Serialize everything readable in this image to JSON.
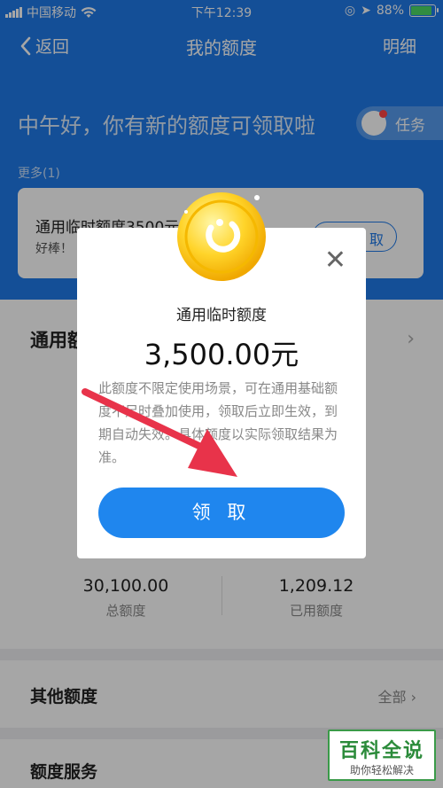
{
  "status_bar": {
    "carrier": "中国移动",
    "time": "下午12:39",
    "battery": "88%"
  },
  "nav": {
    "back": "返回",
    "title": "我的额度",
    "detail": "明细"
  },
  "banner": {
    "greeting": "中午好，你有新的额度可领取啦",
    "task": "任务",
    "more": "更多(1)",
    "card_title": "通用临时额度3500元",
    "card_sub": "好棒！",
    "card_button": "取"
  },
  "quota": {
    "heading": "通用额",
    "total_value": "30,100.00",
    "total_label": "总额度",
    "used_value": "1,209.12",
    "used_label": "已用额度"
  },
  "other": {
    "heading": "其他额度",
    "all": "全部"
  },
  "service": {
    "heading": "额度服务"
  },
  "modal": {
    "label": "通用临时额度",
    "amount": "3,500.00元",
    "description": "此额度不限定使用场景，可在通用基础额度不足时叠加使用，领取后立即生效，到期自动失效。具体额度以实际领取结果为准。",
    "button": "领 取"
  },
  "watermark": {
    "title": "百科全说",
    "subtitle": "助你轻松解决"
  },
  "colors": {
    "primary": "#1f7ae9",
    "arrow": "#e8334a"
  },
  "icons": [
    "signal-icon",
    "wifi-icon",
    "battery-icon",
    "back-chevron-icon",
    "task-icon",
    "close-icon",
    "coin-icon",
    "chevron-right-icon"
  ]
}
